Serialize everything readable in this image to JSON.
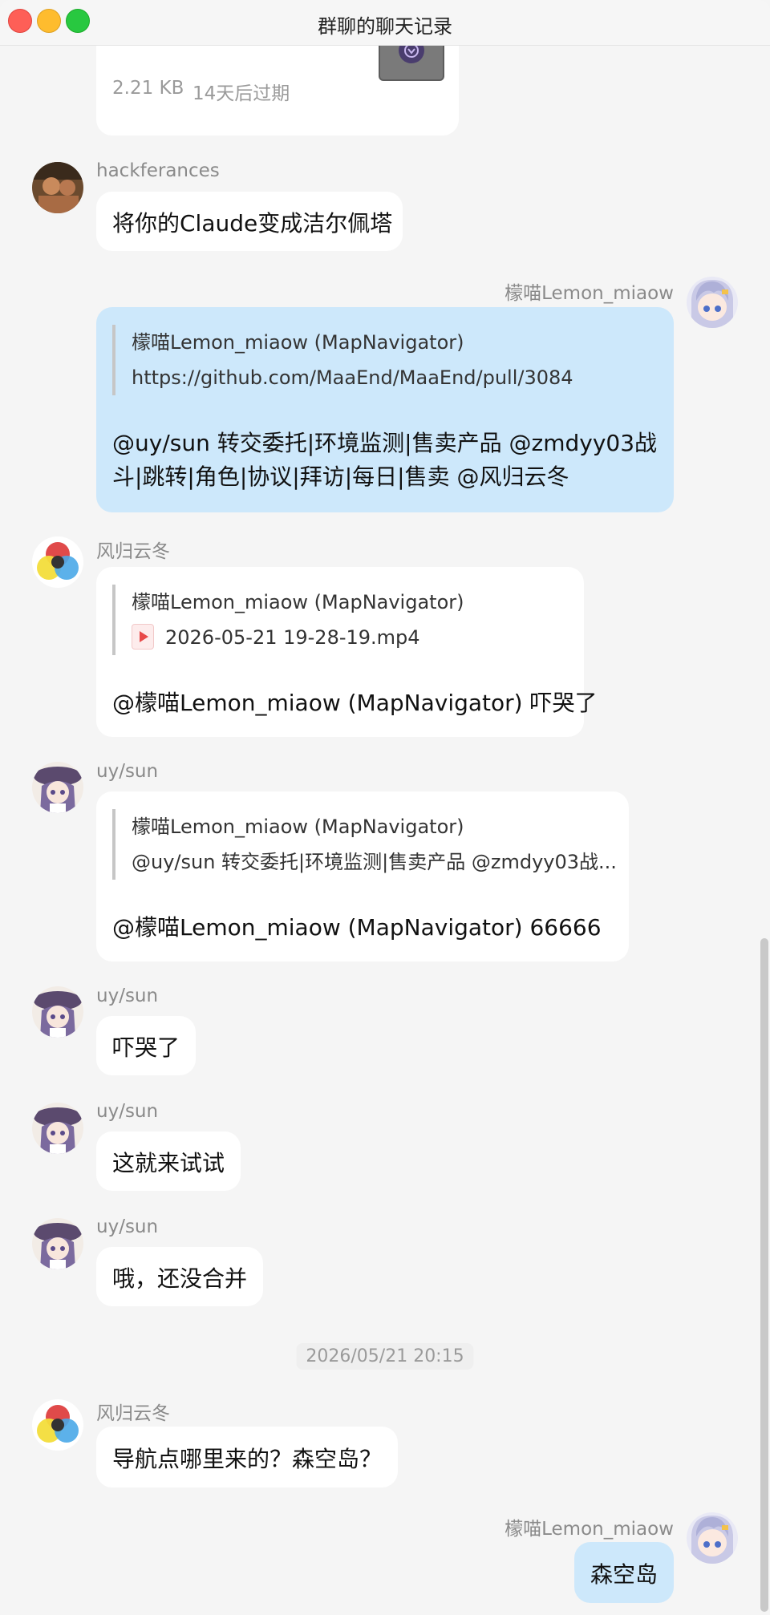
{
  "window": {
    "title": "群聊的聊天记录"
  },
  "file_card": {
    "size": "2.21 KB",
    "expiry": "14天后过期"
  },
  "messages": {
    "m1": {
      "sender": "hackferances",
      "text": "将你的Claude变成洁尔佩塔"
    },
    "m2": {
      "sender": "檬喵Lemon_miaow",
      "quote_author": "檬喵Lemon_miaow (MapNavigator)",
      "quote_text": "https://github.com/MaaEnd/MaaEnd/pull/3084",
      "line1": "@uy/sun 转交委托|环境监测|售卖产品 @zmdyy03战",
      "line2": "斗|跳转|角色|协议|拜访|每日|售卖 @风归云冬"
    },
    "m3": {
      "sender": "风归云冬",
      "quote_author": "檬喵Lemon_miaow (MapNavigator)",
      "quote_file": "2026-05-21 19-28-19.mp4",
      "text": "@檬喵Lemon_miaow (MapNavigator) 吓哭了"
    },
    "m4": {
      "sender": "uy/sun",
      "quote_author": "檬喵Lemon_miaow (MapNavigator)",
      "quote_text": "@uy/sun 转交委托|环境监测|售卖产品 @zmdyy03战...",
      "text": "@檬喵Lemon_miaow (MapNavigator) 66666"
    },
    "m5": {
      "sender": "uy/sun",
      "text": "吓哭了"
    },
    "m6": {
      "sender": "uy/sun",
      "text": "这就来试试"
    },
    "m7": {
      "sender": "uy/sun",
      "text": "哦，还没合并"
    },
    "timestamp": "2026/05/21 20:15",
    "m8": {
      "sender": "风归云冬",
      "text": "导航点哪里来的？森空岛？"
    },
    "m9": {
      "sender": "檬喵Lemon_miaow",
      "text": "森空岛"
    }
  },
  "colors": {
    "bubble_mine": "#cde8fb",
    "bubble_other": "#ffffff",
    "background": "#f5f5f5"
  }
}
